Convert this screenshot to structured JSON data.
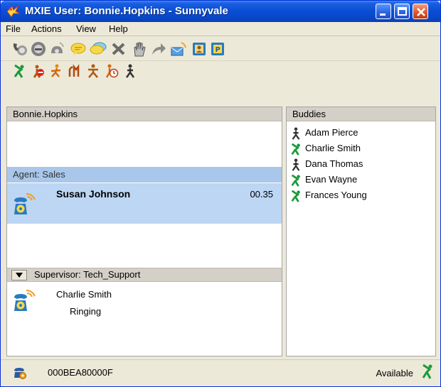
{
  "window": {
    "title": "MXIE User: Bonnie.Hopkins - Sunnyvale"
  },
  "menu": [
    "File",
    "Actions",
    "View",
    "Help"
  ],
  "toolbar_icons": [
    "phone-handset-icon",
    "voicemail-icon",
    "call-device-icon",
    "chat-bubble-icon",
    "group-chat-icon",
    "hang-up-icon",
    "hold-hand-icon",
    "transfer-arrow-icon",
    "email-icon",
    "contacts-card-icon",
    "park-icon"
  ],
  "presence_icons": [
    "available-icon",
    "do-not-disturb-icon",
    "away-icon",
    "meeting-icon",
    "busy-icon",
    "timed-away-icon",
    "offline-icon"
  ],
  "user_panel": {
    "header": "Bonnie.Hopkins"
  },
  "agent_queue": {
    "header": "Agent: Sales",
    "call": {
      "caller": "Susan Johnson",
      "duration": "00.35"
    }
  },
  "supervisor_queue": {
    "header": "Supervisor: Tech_Support",
    "call": {
      "caller": "Charlie Smith",
      "status": "Ringing"
    }
  },
  "buddies": {
    "header": "Buddies",
    "items": [
      {
        "name": "Adam Pierce",
        "presence": "offline"
      },
      {
        "name": "Charlie Smith",
        "presence": "available"
      },
      {
        "name": "Dana Thomas",
        "presence": "offline"
      },
      {
        "name": "Evan Wayne",
        "presence": "available"
      },
      {
        "name": "Frances Young",
        "presence": "available"
      }
    ]
  },
  "status_bar": {
    "device_id": "000BEA80000F",
    "presence": "Available"
  },
  "colors": {
    "title_bar": "#0a4fd6",
    "agent_header": "#a9c7ea",
    "active_call_row": "#bcd6f4",
    "available_green": "#1a9a3a"
  }
}
